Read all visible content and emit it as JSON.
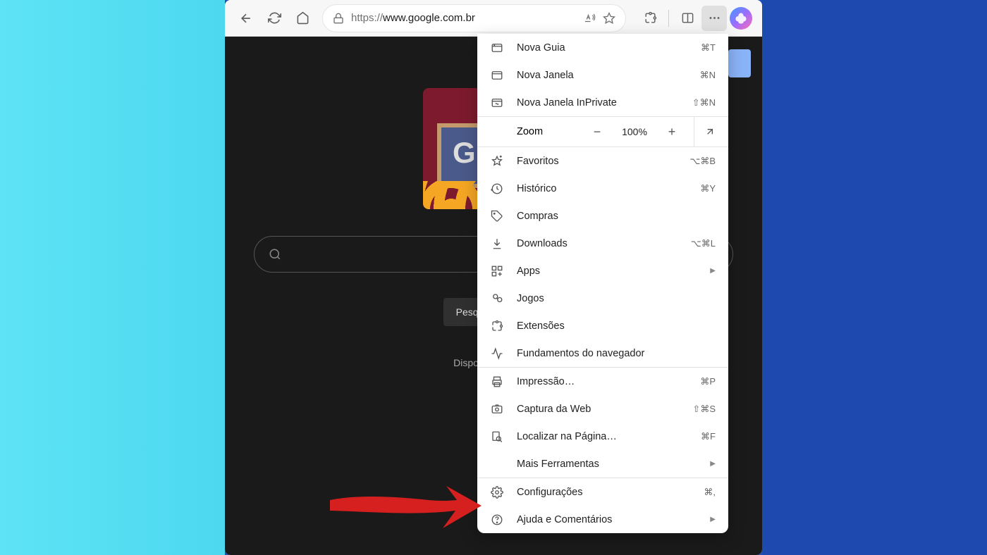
{
  "toolbar": {
    "url_prefix": "https://",
    "url_domain": "www.google.com.br"
  },
  "page": {
    "search_button": "Pesquisa Google",
    "subtext": "Disponibilizado pe"
  },
  "menu": {
    "new_tab": {
      "label": "Nova Guia",
      "shortcut": "⌘T"
    },
    "new_window": {
      "label": "Nova Janela",
      "shortcut": "⌘N"
    },
    "new_inprivate": {
      "label": "Nova Janela InPrivate",
      "shortcut": "⇧⌘N"
    },
    "zoom": {
      "label": "Zoom",
      "value": "100%"
    },
    "favorites": {
      "label": "Favoritos",
      "shortcut": "⌥⌘B"
    },
    "history": {
      "label": "Histórico",
      "shortcut": "⌘Y"
    },
    "shopping": {
      "label": "Compras"
    },
    "downloads": {
      "label": "Downloads",
      "shortcut": "⌥⌘L"
    },
    "apps": {
      "label": "Apps"
    },
    "games": {
      "label": "Jogos"
    },
    "extensions": {
      "label": "Extensões"
    },
    "essentials": {
      "label": "Fundamentos do navegador"
    },
    "print": {
      "label": "Impressão…",
      "shortcut": "⌘P"
    },
    "capture": {
      "label": "Captura da Web",
      "shortcut": "⇧⌘S"
    },
    "find": {
      "label": "Localizar na Página…",
      "shortcut": "⌘F"
    },
    "more_tools": {
      "label": "Mais Ferramentas"
    },
    "settings": {
      "label": "Configurações",
      "shortcut": "⌘,"
    },
    "help": {
      "label": "Ajuda e Comentários"
    }
  }
}
